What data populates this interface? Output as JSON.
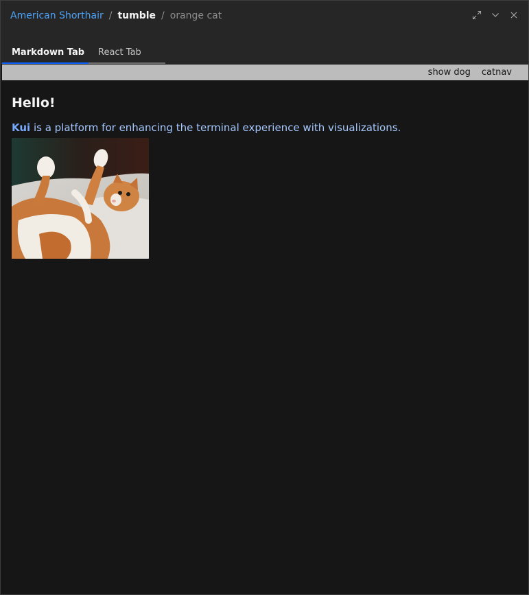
{
  "breadcrumb": {
    "app": "American Shorthair",
    "separator": "/",
    "title": "tumble",
    "subtitle": "orange cat"
  },
  "window_controls": {
    "icons": [
      "maximize-icon",
      "chevron-down-icon",
      "close-icon"
    ]
  },
  "tabs": [
    {
      "label": "Markdown Tab",
      "active": true
    },
    {
      "label": "React Tab",
      "active": false
    }
  ],
  "toolbar": {
    "buttons": [
      {
        "label": "show dog"
      },
      {
        "label": "catnav"
      }
    ]
  },
  "content": {
    "heading": "Hello!",
    "link_text": "Kui",
    "paragraph_rest": " is a platform for enhancing the terminal experience with visualizations."
  },
  "colors": {
    "accent": "#0f62fe",
    "link": "#4fa3f7",
    "background": "#161616",
    "header": "#262626",
    "toolbar": "#bcbcbc"
  }
}
